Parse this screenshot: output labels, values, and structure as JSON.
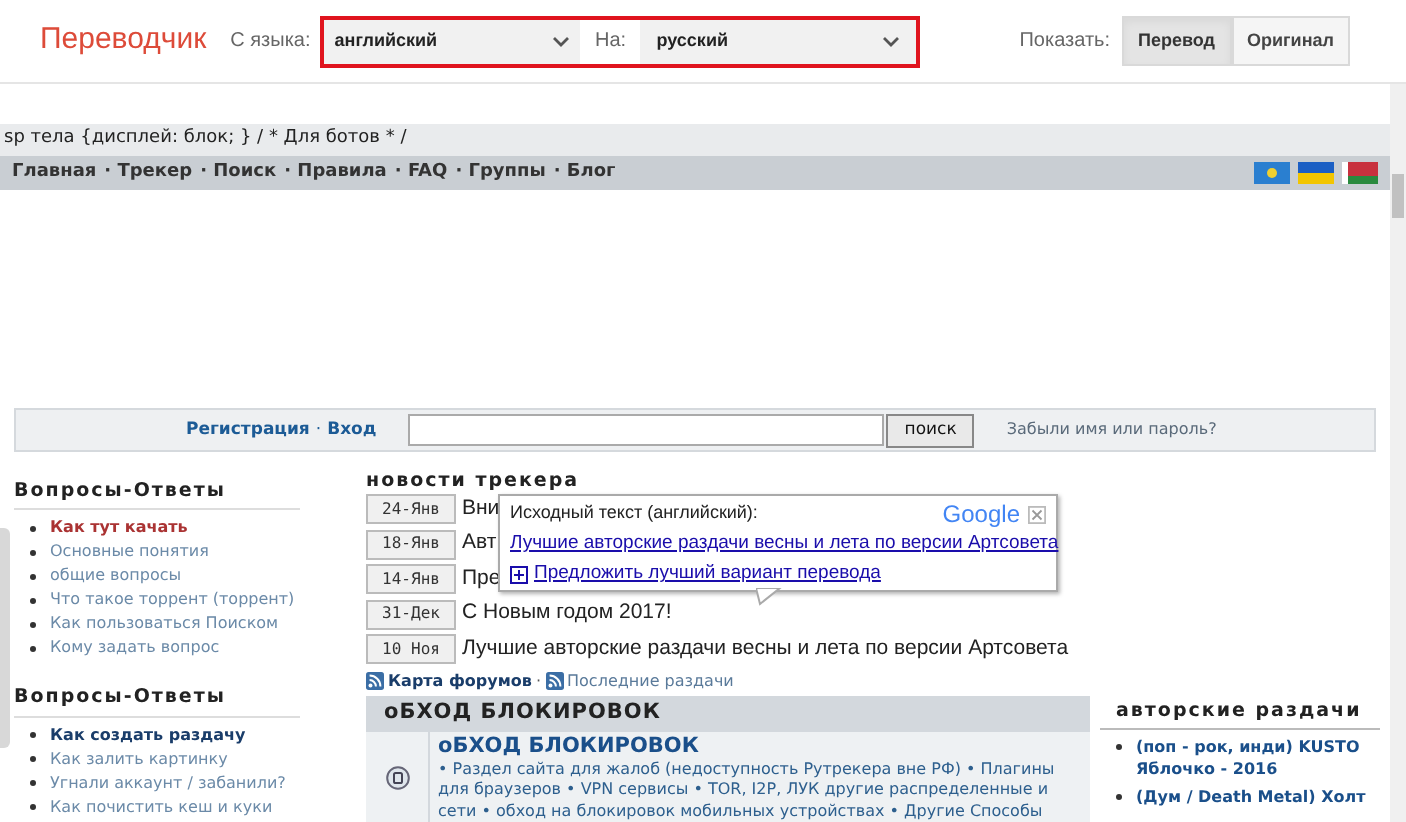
{
  "translate_bar": {
    "title": "Переводчик",
    "from_label": "С языка:",
    "from_value": "английский",
    "to_label": "На:",
    "to_value": "русский",
    "show_label": "Показать:",
    "show_options": [
      {
        "label": "Перевод",
        "selected": true
      },
      {
        "label": "Оригинал",
        "selected": false
      }
    ]
  },
  "css_line": "sp тела {дисплей: блок; } / * Для ботов * /",
  "nav": [
    "Главная",
    "· Трекер",
    "· Поиск",
    "· Правила",
    "· FAQ",
    "· Группы",
    "· Блог"
  ],
  "login": {
    "register": "Регистрация",
    "separator": "·",
    "login": "Вход",
    "search_button": "поиск",
    "forgot": "Забыли имя или пароль?"
  },
  "left_sections": [
    {
      "title": "Вопросы-Ответы",
      "items": [
        {
          "text": "Как тут качать",
          "kind": "current"
        },
        {
          "text": "Основные понятия",
          "kind": "link"
        },
        {
          "text": "общие вопросы",
          "kind": "link"
        },
        {
          "text": "Что такое торрент (торрент)",
          "kind": "link"
        },
        {
          "text": "Как пользоваться Поиском",
          "kind": "link"
        },
        {
          "text": "Кому задать вопрос",
          "kind": "link"
        }
      ]
    },
    {
      "title": "Вопросы-Ответы",
      "items": [
        {
          "text": "Как создать раздачу",
          "kind": "featured"
        },
        {
          "text": "Как залить картинку",
          "kind": "link"
        },
        {
          "text": "Угнали аккаунт / забанили?",
          "kind": "link"
        },
        {
          "text": "Как почистить кеш и куки",
          "kind": "link"
        }
      ]
    }
  ],
  "news": {
    "title": "новости трекера",
    "rows": [
      {
        "date": "24-Янв",
        "text": "Вни"
      },
      {
        "date": "18-Янв",
        "text": "Авт"
      },
      {
        "date": "14-Янв",
        "text": "Пре"
      },
      {
        "date": "31-Дек",
        "text": "С Новым годом 2017!"
      },
      {
        "date": "10 Ноя",
        "text": "Лучшие авторские раздачи весны и лета по версии Артсовета"
      }
    ]
  },
  "feeds": {
    "forum_map": "Карта форумов",
    "separator": "·",
    "latest": "Последние раздачи"
  },
  "forum": {
    "header": "оБХОД БЛОКИРОВОК",
    "title": "оБХОД БЛОКИРОВОК",
    "subforums": "• Раздел сайта для жалоб (недоступность Рутрекера вне РФ) • Плагины для браузеров • VPN сервисы • TOR, I2P, ЛУК другие распределенные и сети • обход на блокировок мобильных устройствах • Другие Способы"
  },
  "right": {
    "title": "авторские раздачи",
    "items": [
      "(поп - рок, инди) KUSTO Яблочко - 2016",
      "(Дум / Death Metal) Холт"
    ]
  },
  "popup": {
    "label": "Исходный текст (английский):",
    "brand": "Google",
    "source": "Лучшие авторские раздачи весны и лета по версии Артсовета",
    "suggest": "Предложить лучший вариант перевода"
  }
}
